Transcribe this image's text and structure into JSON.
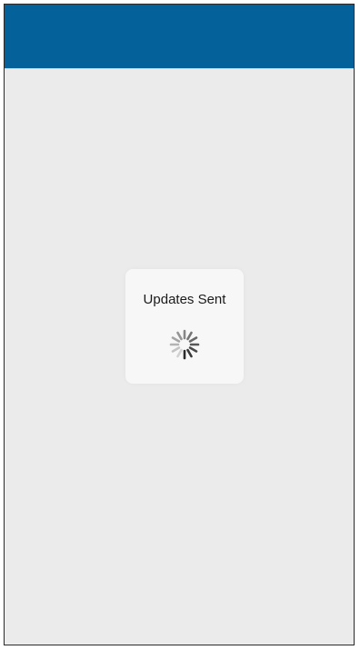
{
  "colors": {
    "navbar": "#04619a",
    "background": "#ebebeb",
    "hud_background": "#f7f7f7"
  },
  "hud": {
    "message": "Updates Sent",
    "indicator_icon": "activity-spinner-icon"
  }
}
